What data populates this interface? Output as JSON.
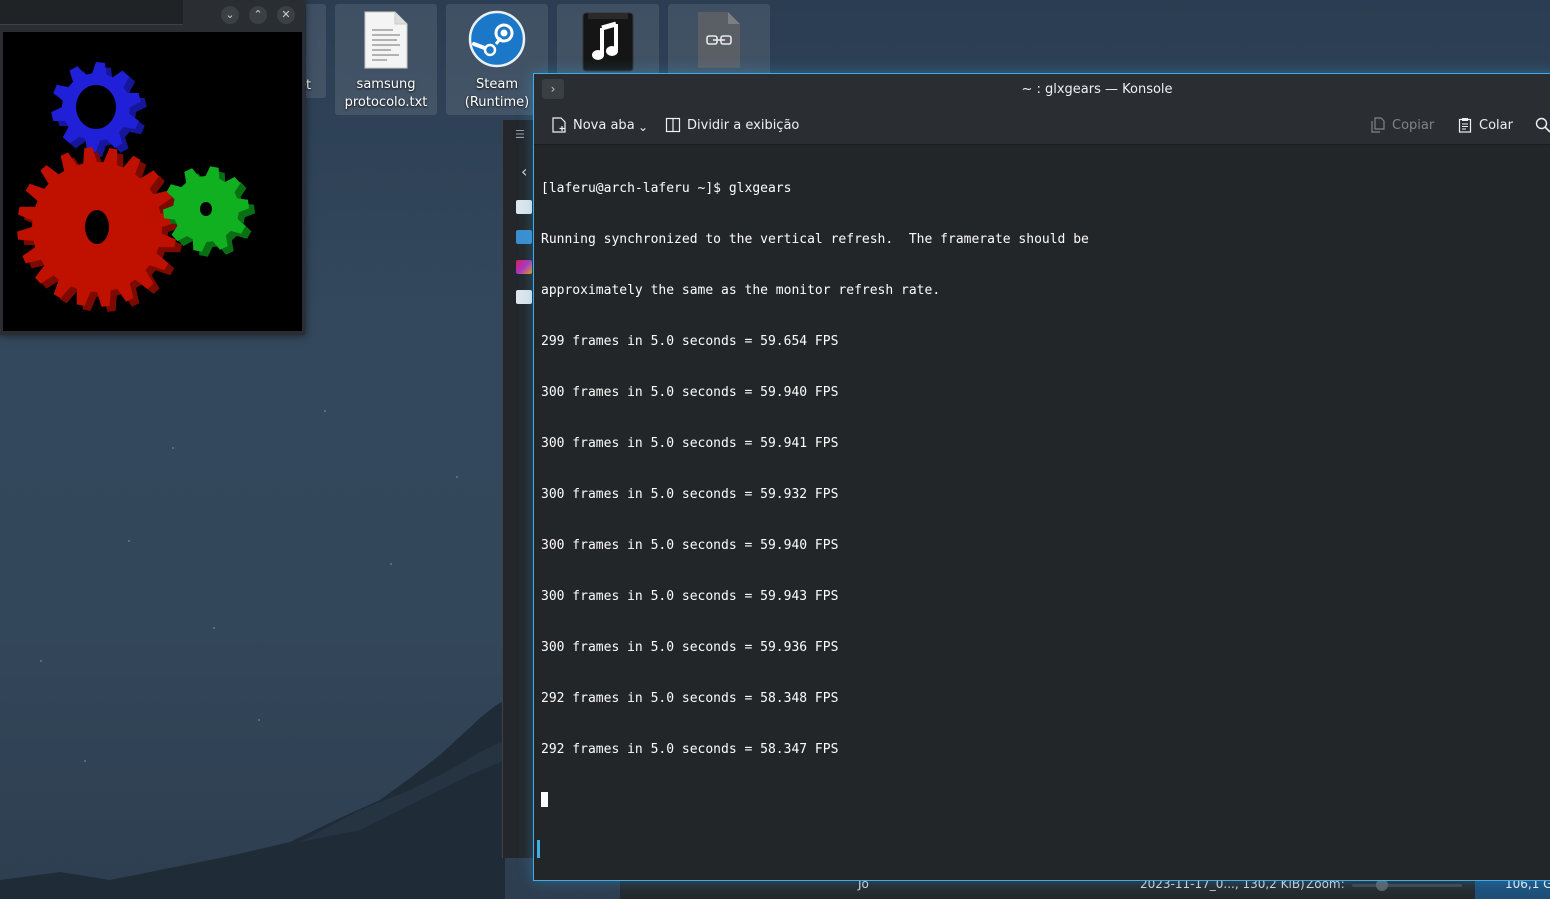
{
  "desktop": {
    "icons": [
      {
        "label": "samsung\nprotocolo.txt",
        "icon": "text-file-icon"
      },
      {
        "label": "Steam\n(Runtime)",
        "icon": "steam-icon"
      },
      {
        "label": "",
        "icon": "music-folder-icon"
      },
      {
        "label": "",
        "icon": "link-file-icon"
      }
    ],
    "partial_label": "et"
  },
  "gears_window": {
    "buttons": [
      "minimize",
      "maximize",
      "close"
    ]
  },
  "konsole": {
    "title": "~ : glxgears — Konsole",
    "toolbar": {
      "new_tab": "Nova aba",
      "split_view": "Dividir a exibição",
      "copy": "Copiar",
      "paste": "Colar"
    },
    "lines": [
      "[laferu@arch-laferu ~]$ glxgears",
      "Running synchronized to the vertical refresh.  The framerate should be",
      "approximately the same as the monitor refresh rate.",
      "299 frames in 5.0 seconds = 59.654 FPS",
      "300 frames in 5.0 seconds = 59.940 FPS",
      "300 frames in 5.0 seconds = 59.941 FPS",
      "300 frames in 5.0 seconds = 59.932 FPS",
      "300 frames in 5.0 seconds = 59.940 FPS",
      "300 frames in 5.0 seconds = 59.943 FPS",
      "300 frames in 5.0 seconds = 59.936 FPS",
      "292 frames in 5.0 seconds = 58.348 FPS",
      "292 frames in 5.0 seconds = 58.347 FPS"
    ]
  },
  "statusbar": {
    "left_fragment": "Jo",
    "file_info": "2023-11-17_0..., 130,2 KiB)",
    "zoom_label": "Zoom:",
    "free_space": "106,1 G"
  },
  "colors": {
    "accent": "#3daee9",
    "gear_red": "#c01000",
    "gear_green": "#10b020",
    "gear_blue": "#2020d8"
  }
}
